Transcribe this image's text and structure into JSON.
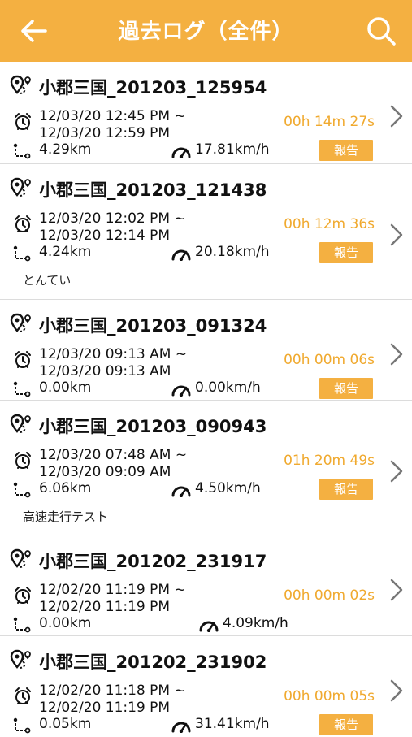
{
  "header": {
    "title": "過去ログ（全件）",
    "back_icon": "back-arrow-icon",
    "search_icon": "search-icon"
  },
  "colors": {
    "accent": "#f4b041",
    "duration": "#f0a92e",
    "divider": "#dcdcdc"
  },
  "entries": [
    {
      "name": "小郡三国_201203_125954",
      "time_start": "12/03/20 12:45 PM ~",
      "time_end": "12/03/20 12:59 PM",
      "distance": "4.29km",
      "speed": "17.81km/h",
      "duration": "00h 14m 27s",
      "report_label": "報告",
      "memo": ""
    },
    {
      "name": "小郡三国_201203_121438",
      "time_start": "12/03/20 12:02 PM ~",
      "time_end": "12/03/20 12:14 PM",
      "distance": "4.24km",
      "speed": "20.18km/h",
      "duration": "00h 12m 36s",
      "report_label": "報告",
      "memo": "とんてい"
    },
    {
      "name": "小郡三国_201203_091324",
      "time_start": "12/03/20 09:13 AM ~",
      "time_end": "12/03/20 09:13 AM",
      "distance": "0.00km",
      "speed": "0.00km/h",
      "duration": "00h 00m 06s",
      "report_label": "報告",
      "memo": ""
    },
    {
      "name": "小郡三国_201203_090943",
      "time_start": "12/03/20 07:48 AM ~",
      "time_end": "12/03/20 09:09 AM",
      "distance": "6.06km",
      "speed": "4.50km/h",
      "duration": "01h 20m 49s",
      "report_label": "報告",
      "memo": "高速走行テスト"
    },
    {
      "name": "小郡三国_201202_231917",
      "time_start": "12/02/20 11:19 PM ~",
      "time_end": "12/02/20 11:19 PM",
      "distance": "0.00km",
      "speed": "4.09km/h",
      "duration": "00h 00m 02s",
      "report_label": "",
      "memo": ""
    },
    {
      "name": "小郡三国_201202_231902",
      "time_start": "12/02/20 11:18 PM ~",
      "time_end": "12/02/20 11:19 PM",
      "distance": "0.05km",
      "speed": "31.41km/h",
      "duration": "00h 00m 05s",
      "report_label": "報告",
      "memo": ""
    }
  ]
}
